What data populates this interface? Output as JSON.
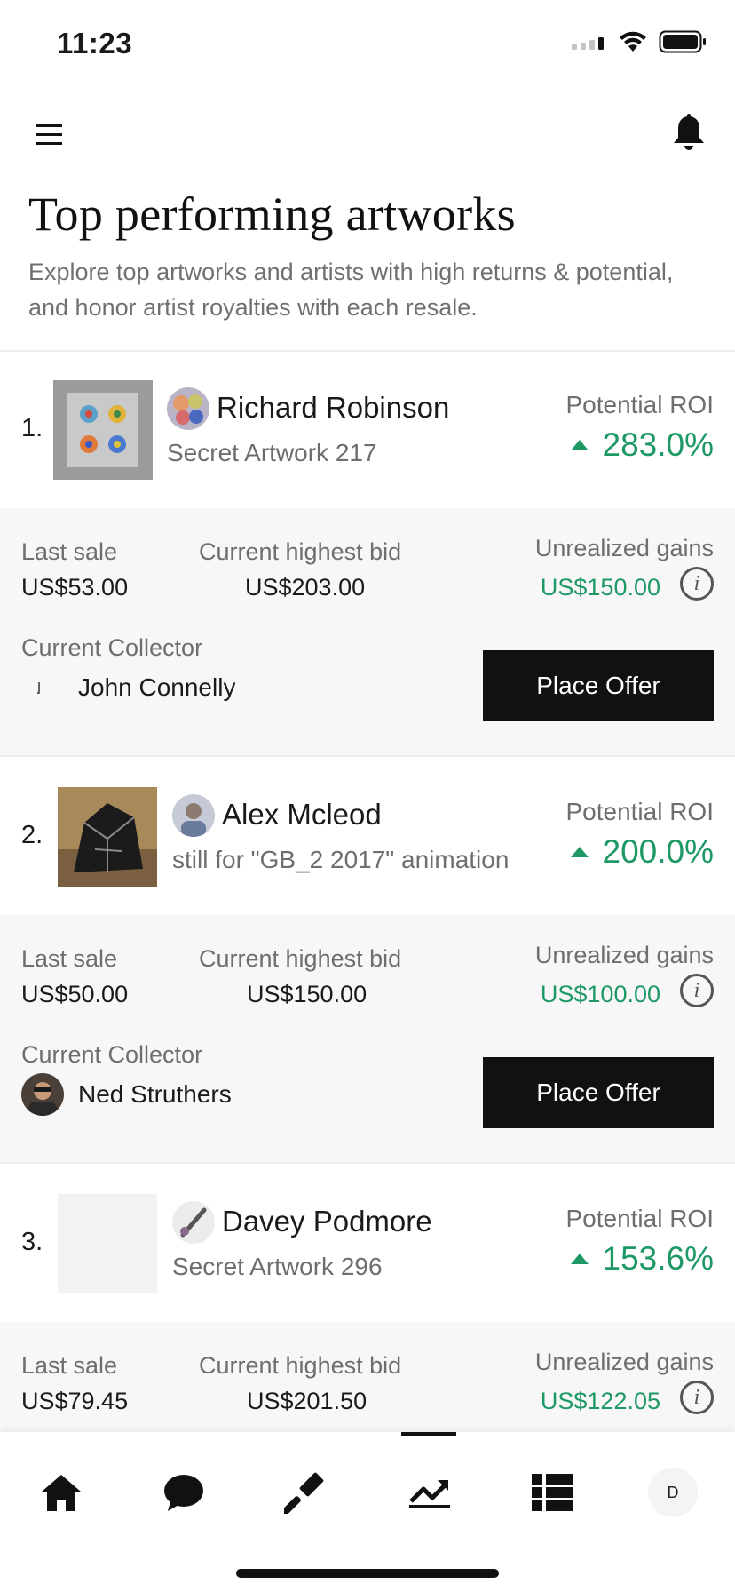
{
  "status_bar": {
    "time": "11:23"
  },
  "header": {
    "title": "Top performing artworks",
    "subtitle": "Explore top artworks and artists with high returns & potential, and honor artist royalties with each resale."
  },
  "labels": {
    "potential_roi": "Potential ROI",
    "last_sale": "Last sale",
    "current_highest_bid": "Current highest bid",
    "unrealized_gains": "Unrealized gains",
    "current_collector": "Current Collector",
    "place_offer": "Place Offer",
    "info_glyph": "i"
  },
  "artworks": [
    {
      "rank": "1.",
      "artist": "Richard Robinson",
      "title": "Secret Artwork 217",
      "roi": "283.0%",
      "last_sale": "US$53.00",
      "highest_bid": "US$203.00",
      "gains": "US$150.00",
      "collector": "John Connelly"
    },
    {
      "rank": "2.",
      "artist": "Alex Mcleod",
      "title": "still for \"GB_2 2017\" animation",
      "roi": "200.0%",
      "last_sale": "US$50.00",
      "highest_bid": "US$150.00",
      "gains": "US$100.00",
      "collector": "Ned Struthers"
    },
    {
      "rank": "3.",
      "artist": "Davey Podmore",
      "title": "Secret Artwork 296",
      "roi": "153.6%",
      "last_sale": "US$79.45",
      "highest_bid": "US$201.50",
      "gains": "US$122.05",
      "collector": ""
    }
  ],
  "nav": {
    "items": [
      "home-icon",
      "chat-icon",
      "gavel-icon",
      "trending-icon",
      "list-icon",
      "profile-avatar"
    ],
    "active": "trending-icon",
    "profile_initial": "D"
  },
  "colors": {
    "accent_green": "#1e9966",
    "button_dark": "#111111"
  }
}
